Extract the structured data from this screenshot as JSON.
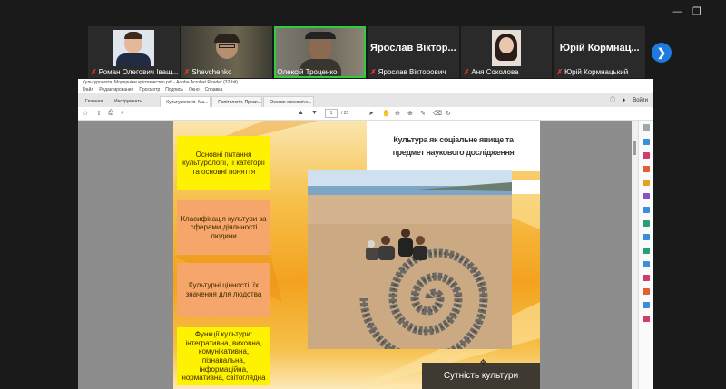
{
  "window": {
    "minimize_icon": "minimize-icon",
    "restore_icon": "restore-icon"
  },
  "participants": [
    {
      "name": "Роман Олегович Іващ...",
      "muted": true,
      "type": "photo"
    },
    {
      "name": "Shevchenko",
      "muted": true,
      "type": "video"
    },
    {
      "name": "Олексій Троценко",
      "muted": false,
      "type": "video",
      "active": true
    },
    {
      "name": "Ярослав Вікторович",
      "muted": true,
      "type": "text",
      "bigname": "Ярослав Віктор..."
    },
    {
      "name": "Аня Соколова",
      "muted": true,
      "type": "photo"
    },
    {
      "name": "Юрій Кормнацький",
      "muted": true,
      "type": "text",
      "bigname": "Юрій Кормнац..."
    }
  ],
  "acrobat": {
    "title": "Культурологія. Модернізм кріптичество.pdf - Adobe Acrobat Reader (32-bit)",
    "menu": [
      "Файл",
      "Редактирование",
      "Просмотр",
      "Подпись",
      "Окно",
      "Справка"
    ],
    "tabs": [
      "Главная",
      "Инструменты"
    ],
    "doc_tabs": [
      "Культурологія. Ма...",
      "Політологія. Прези...",
      "Основи економічн..."
    ],
    "sign_in": "Войти",
    "page_current": "1",
    "page_total": "/ 25",
    "toolbar_icons": [
      "save-icon",
      "print-icon",
      "search-icon",
      "upload-icon",
      "download-icon"
    ]
  },
  "slide": {
    "title_line1": "Культура як соціальне явище та",
    "title_line2": "предмет наукового дослідження",
    "boxes": [
      "Основні питання культурології, її категорії та основні поняття",
      "Класифікація культури за сферами діяльності людини",
      "Культурні цінності, їх значення для людства",
      "Функції культури: інтегративна, виховна, комунікативна, пізнавальна, інформаційна, нормативна, світоглядна"
    ],
    "bottom_label": "Сутність культури",
    "colors": {
      "yellow": "#fff200",
      "orange": "#f6a66a",
      "dark": "#3e3a32"
    }
  }
}
